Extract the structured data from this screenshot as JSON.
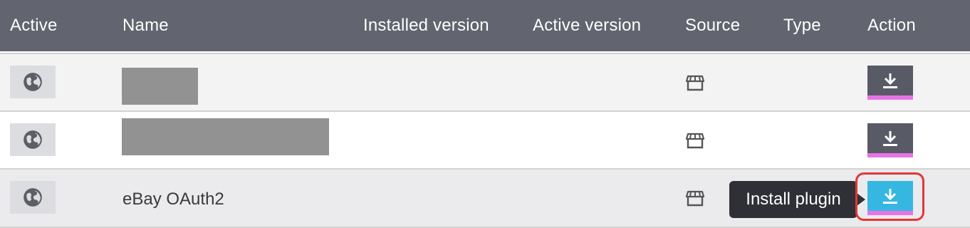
{
  "table": {
    "columns": {
      "active": "Active",
      "name": "Name",
      "installed_version": "Installed version",
      "active_version": "Active version",
      "source": "Source",
      "type": "Type",
      "action": "Action"
    },
    "rows": [
      {
        "name": "",
        "name_redacted": true,
        "active_icon": "globe-icon",
        "source_icon": "store-icon",
        "action_icon": "download-icon"
      },
      {
        "name": "",
        "name_redacted": true,
        "active_icon": "globe-icon",
        "source_icon": "store-icon",
        "action_icon": "download-icon"
      },
      {
        "name": "eBay OAuth2",
        "name_redacted": false,
        "active_icon": "globe-icon",
        "source_icon": "store-icon",
        "action_icon": "download-icon"
      }
    ]
  },
  "tooltip": {
    "text": "Install plugin"
  },
  "colors": {
    "header_bg": "#62646f",
    "button_bg": "#585a66",
    "button_hover_bg": "#35b7e2",
    "button_accent": "#e674e6",
    "highlight_ring": "#e53535"
  }
}
